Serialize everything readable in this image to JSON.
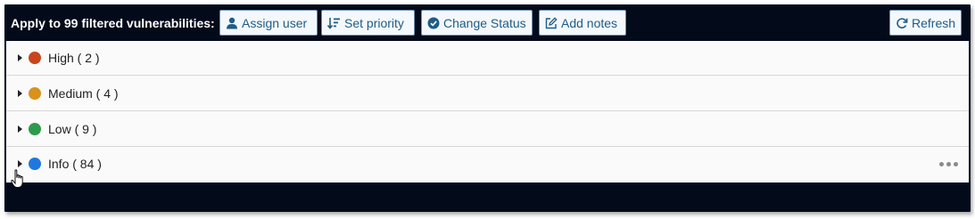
{
  "toolbar": {
    "apply_label": "Apply to 99 filtered vulnerabilities:",
    "buttons": {
      "assign_user": "Assign user",
      "set_priority": "Set priority",
      "change_status": "Change Status",
      "add_notes": "Add notes",
      "refresh": "Refresh"
    },
    "icons": {
      "assign_user": "user-icon",
      "set_priority": "sort-icon",
      "change_status": "check-circle-icon",
      "add_notes": "edit-icon",
      "refresh": "refresh-icon"
    }
  },
  "groups": [
    {
      "label": "High ( 2 )",
      "color": "#c9451c"
    },
    {
      "label": "Medium ( 4 )",
      "color": "#d9921c"
    },
    {
      "label": "Low ( 9 )",
      "color": "#2e9a4c"
    },
    {
      "label": "Info ( 84 )",
      "color": "#1f78e0"
    }
  ],
  "colors": {
    "toolbar_bg": "#030a1a",
    "button_text": "#1f5c86",
    "button_border": "#6a8fb0"
  }
}
